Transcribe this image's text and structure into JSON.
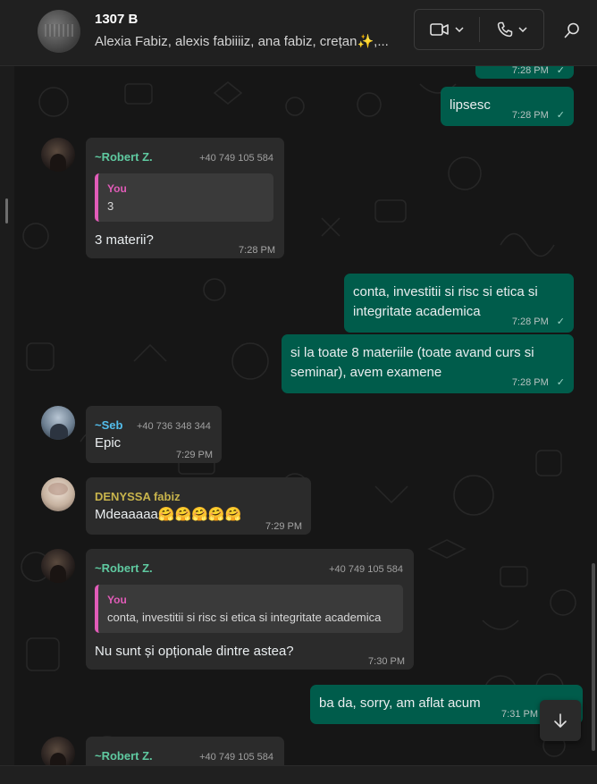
{
  "header": {
    "group_name": "1307 B",
    "participants": "Alexia Fabiz, alexis fabiiiiz, ana fabiz, crețan✨,..."
  },
  "colors": {
    "incoming_bubble": "#2b2b2b",
    "outgoing_bubble": "#005c4b",
    "robert_name": "#5fc9a0",
    "seb_name": "#53bdeb",
    "denyssa_name": "#c8b44c",
    "quote_accent": "#e15cb8"
  },
  "messages": [
    {
      "id": "m0",
      "time": "7:28 PM"
    },
    {
      "id": "m1",
      "text": "lipsesc",
      "time": "7:28 PM"
    },
    {
      "id": "m2",
      "sender": "~Robert Z.",
      "phone": "+40 749 105 584",
      "quote_name": "You",
      "quote_text": "3",
      "text": "3 materii?",
      "time": "7:28 PM"
    },
    {
      "id": "m3",
      "line1": "conta, investitii si risc si etica si",
      "line2": "integritate academica",
      "time": "7:28 PM"
    },
    {
      "id": "m4",
      "line1": "si la toate 8 materiile (toate avand curs si",
      "line2": "seminar), avem examene",
      "time": "7:28 PM"
    },
    {
      "id": "m5",
      "sender": "~Seb",
      "phone": "+40 736 348 344",
      "text": "Epic",
      "time": "7:29 PM"
    },
    {
      "id": "m6",
      "sender": "DENYSSA fabiz",
      "text": "Mdeaaaaa",
      "emoji": "🤗🤗🤗🤗🤗",
      "time": "7:29 PM"
    },
    {
      "id": "m7",
      "sender": "~Robert Z.",
      "phone": "+40 749 105 584",
      "quote_name": "You",
      "quote_text": "conta, investitii si risc si etica si integritate academica",
      "text": "Nu sunt și opționale dintre astea?",
      "time": "7:30 PM"
    },
    {
      "id": "m8",
      "text": "ba da, sorry, am aflat acum",
      "time": "7:31 PM"
    },
    {
      "id": "m9",
      "sender": "~Robert Z.",
      "phone": "+40 749 105 584"
    }
  ],
  "icons": {
    "video": "video-camera-icon",
    "voice": "phone-icon",
    "search": "search-icon",
    "scroll": "arrow-down-icon",
    "read": "double-check-icon"
  }
}
